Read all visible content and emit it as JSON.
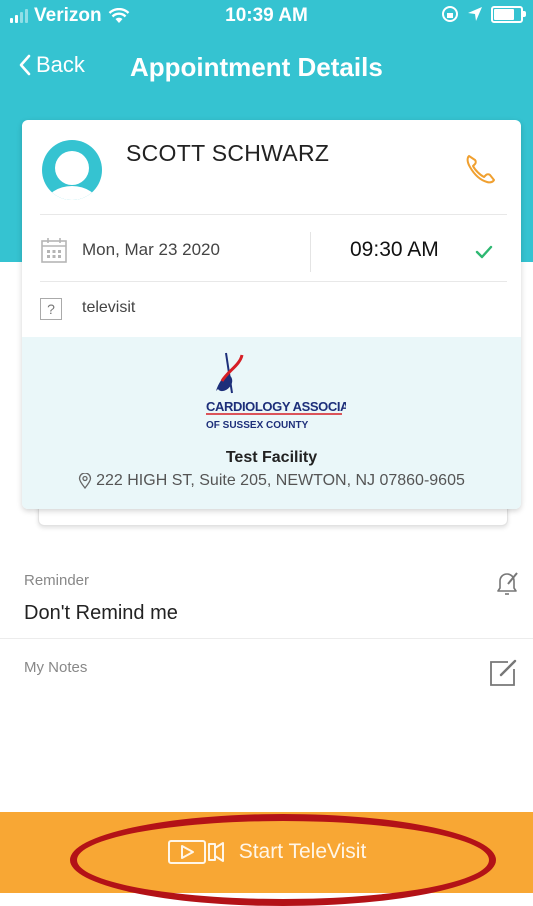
{
  "status_bar": {
    "carrier": "Verizon",
    "time": "10:39 AM"
  },
  "nav": {
    "back_label": "Back",
    "title": "Appointment Details"
  },
  "appointment": {
    "patient_name": "SCOTT SCHWARZ",
    "date": "Mon, Mar 23  2020",
    "time": "09:30 AM",
    "visit_type": "televisit"
  },
  "facility": {
    "logo_line1": "CARDIOLOGY ASSOCIATES",
    "logo_line2": "OF SUSSEX COUNTY",
    "name": "Test Facility",
    "address": "222 HIGH ST, Suite 205, NEWTON, NJ 07860-9605"
  },
  "reminder": {
    "label": "Reminder",
    "value": "Don't Remind me"
  },
  "notes": {
    "label": "My Notes"
  },
  "action": {
    "start_label": "Start TeleVisit"
  },
  "colors": {
    "header_teal": "#35c3d1",
    "accent_orange": "#f8a734",
    "check_green": "#2eb872",
    "highlight_red": "#b31217"
  }
}
